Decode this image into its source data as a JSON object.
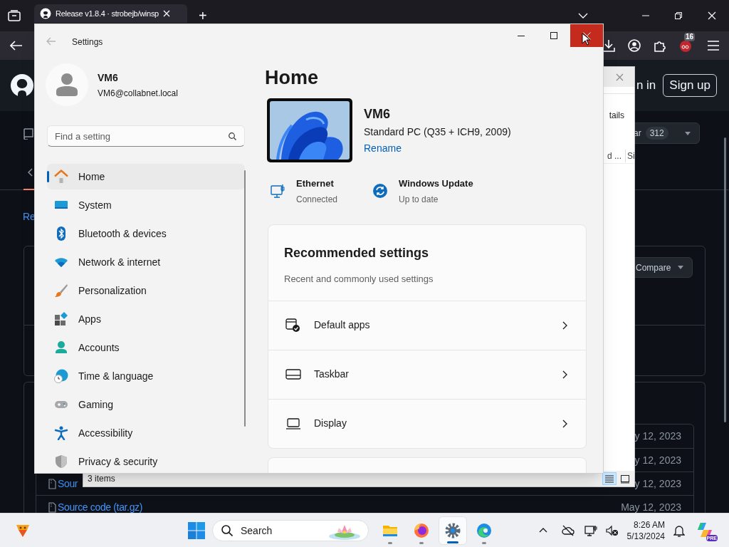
{
  "browser": {
    "tabs": [
      {
        "title": "Release v1.8.4 · strobejb/winsp",
        "selected": true
      }
    ],
    "new_tab_label": "+",
    "extension_badge": "16"
  },
  "github": {
    "header_link": "n in",
    "sign_up": "Sign up",
    "nav_link": "Re",
    "star_button": {
      "label": "ar",
      "count": "312"
    },
    "compare_button": "Compare",
    "assets": [
      {
        "date": "y 12, 2023"
      },
      {
        "date": "y 12, 2023"
      },
      {
        "name": "Sour",
        "date": "y 12, 2023"
      },
      {
        "name": "Source code (tar.gz)",
        "date": "May 12, 2023"
      }
    ]
  },
  "file_dialog": {
    "button_label": "tails",
    "columns": [
      "d ...",
      "Si"
    ],
    "status": "3 items",
    "views": [
      {
        "kind": "details",
        "selected": true
      },
      {
        "kind": "tiles",
        "selected": false
      }
    ]
  },
  "settings": {
    "title": "Settings",
    "close_hovered": true,
    "user": {
      "name": "VM6",
      "email": "VM6@collabnet.local"
    },
    "search_placeholder": "Find a setting",
    "nav": [
      {
        "label": "Home",
        "selected": true
      },
      {
        "label": "System",
        "selected": false
      },
      {
        "label": "Bluetooth & devices",
        "selected": false
      },
      {
        "label": "Network & internet",
        "selected": false
      },
      {
        "label": "Personalization",
        "selected": false
      },
      {
        "label": "Apps",
        "selected": false
      },
      {
        "label": "Accounts",
        "selected": false
      },
      {
        "label": "Time & language",
        "selected": false
      },
      {
        "label": "Gaming",
        "selected": false
      },
      {
        "label": "Accessibility",
        "selected": false
      },
      {
        "label": "Privacy & security",
        "selected": false
      }
    ],
    "page_title": "Home",
    "device": {
      "name": "VM6",
      "model": "Standard PC (Q35 + ICH9, 2009)",
      "rename": "Rename"
    },
    "status": [
      {
        "title": "Ethernet",
        "subtitle": "Connected"
      },
      {
        "title": "Windows Update",
        "subtitle": "Up to date"
      }
    ],
    "recommended": {
      "title": "Recommended settings",
      "subtitle": "Recent and commonly used settings",
      "items": [
        "Default apps",
        "Taskbar",
        "Display"
      ]
    }
  },
  "taskbar": {
    "search_placeholder": "Search",
    "apps": [
      {
        "selected": false
      },
      {
        "selected": false
      },
      {
        "selected": true
      },
      {
        "selected": false
      }
    ],
    "time": "8:26 AM",
    "date": "5/13/2024",
    "copilot_badge": "PRE"
  }
}
